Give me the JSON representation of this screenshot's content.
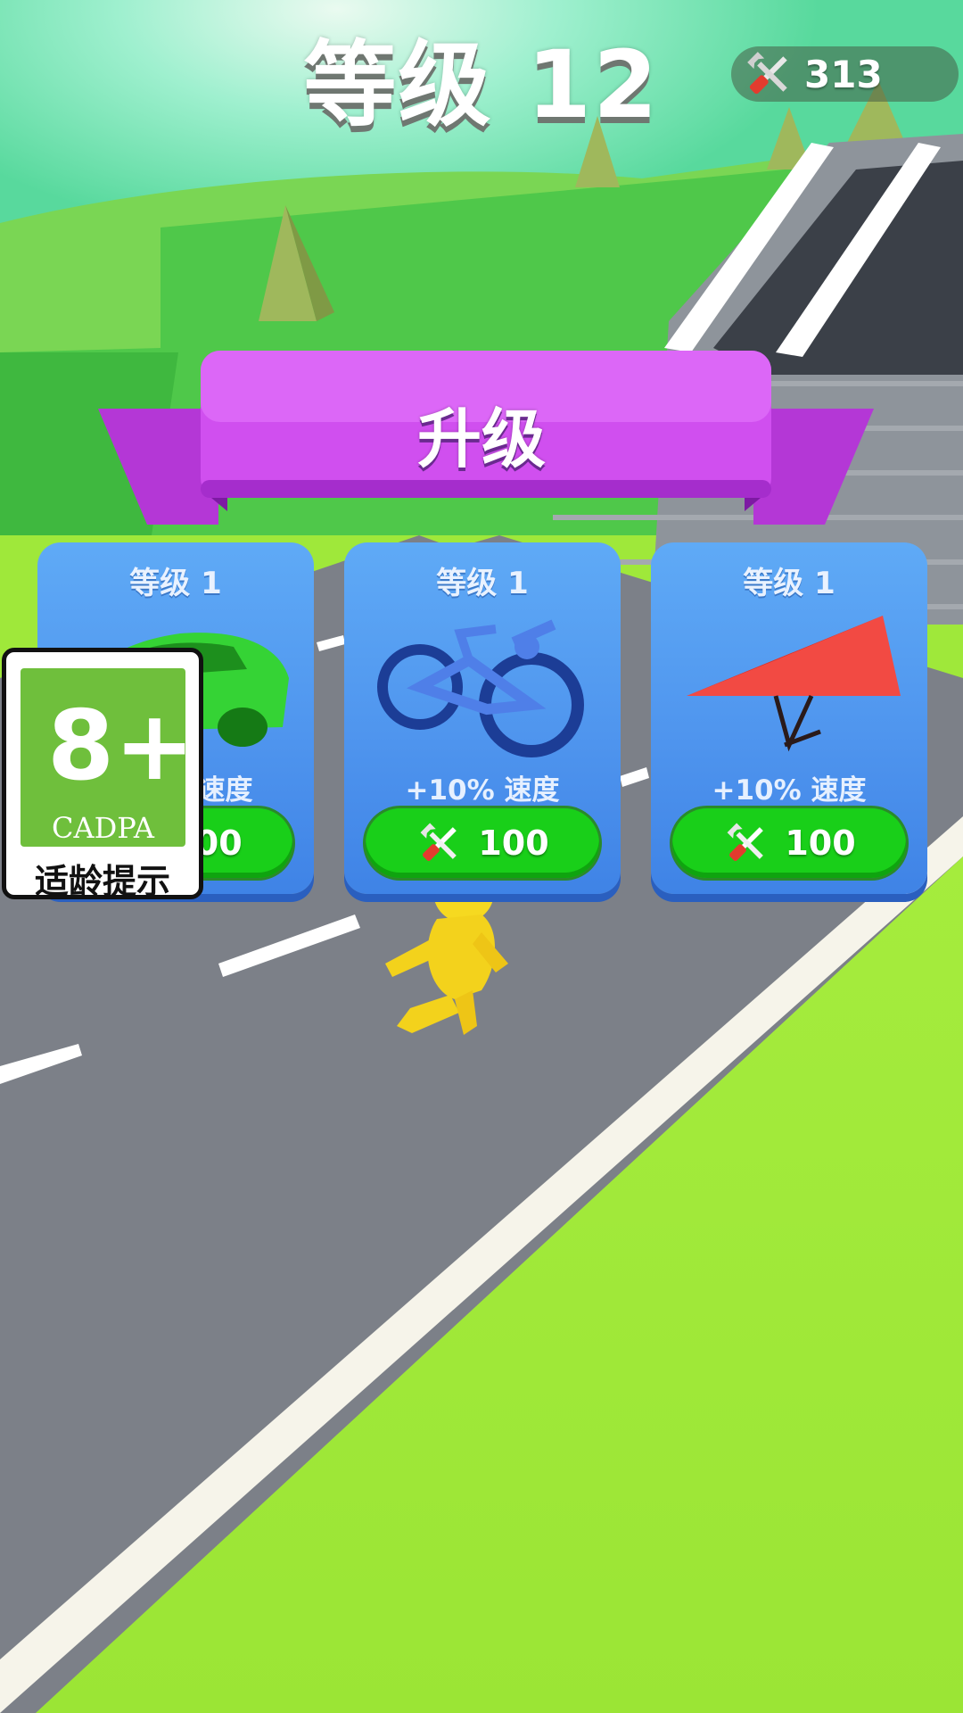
{
  "hud": {
    "level_title": "等级 12",
    "currency_icon": "tools-icon",
    "currency_value": "313"
  },
  "banner": {
    "title": "升级"
  },
  "upgrades": [
    {
      "level": "等级 1",
      "bonus": "+10% 速度",
      "price": "100",
      "item": "car"
    },
    {
      "level": "等级 1",
      "bonus": "+10% 速度",
      "price": "100",
      "item": "bicycle"
    },
    {
      "level": "等级 1",
      "bonus": "+10% 速度",
      "price": "100",
      "item": "hang-glider"
    }
  ],
  "age_badge": {
    "rating": "8+",
    "org": "CADPA",
    "caption": "适龄提示"
  },
  "colors": {
    "banner": "#c94ae8",
    "card": "#4f95ee",
    "buy_button": "#19cf19",
    "road": "#7c8088",
    "grass": "#9fe83a"
  }
}
